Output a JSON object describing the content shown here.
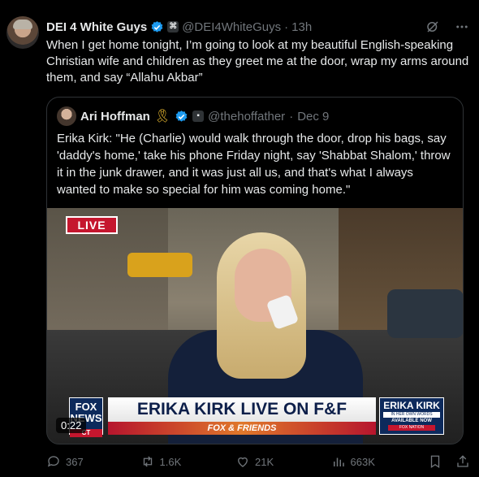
{
  "tweet": {
    "author_name": "DEI 4 White Guys",
    "handle": "@DEI4WhiteGuys",
    "separator": "·",
    "time": "13h",
    "text": "When I get home tonight, I’m going to look at my beautiful English-speaking Christian wife and children as they greet me at the door, wrap my arms around them, and say “Allahu Akbar”"
  },
  "quote": {
    "author_name": "Ari Hoffman",
    "handle": "@thehoffather",
    "separator": "·",
    "time": "Dec 9",
    "text": "Erika Kirk: \"He (Charlie) would walk through the door, drop his bags, say 'daddy's home,' take his phone Friday night, say 'Shabbat Shalom,' throw it in the junk drawer, and it was just all us, and that's what I always wanted to make so special for him was coming home.\"",
    "video": {
      "live_label": "LIVE",
      "headline": "ERIKA KIRK LIVE ON F&F",
      "show_name": "FOX & FRIENDS",
      "logo_text": "FOX NEWS",
      "logo_sub": "CT",
      "side_title": "ERIKA KIRK",
      "side_sub": "IN HER OWN WORDS",
      "side_available": "AVAILABLE NOW",
      "side_network": "FOX NATION",
      "duration": "0:22"
    }
  },
  "actions": {
    "replies": "367",
    "reposts": "1.6K",
    "likes": "21K",
    "views": "663K"
  },
  "colors": {
    "background": "#000000",
    "text": "#e7e9ea",
    "muted": "#71767b",
    "verified": "#1d9bf0",
    "border": "#2f3336"
  }
}
